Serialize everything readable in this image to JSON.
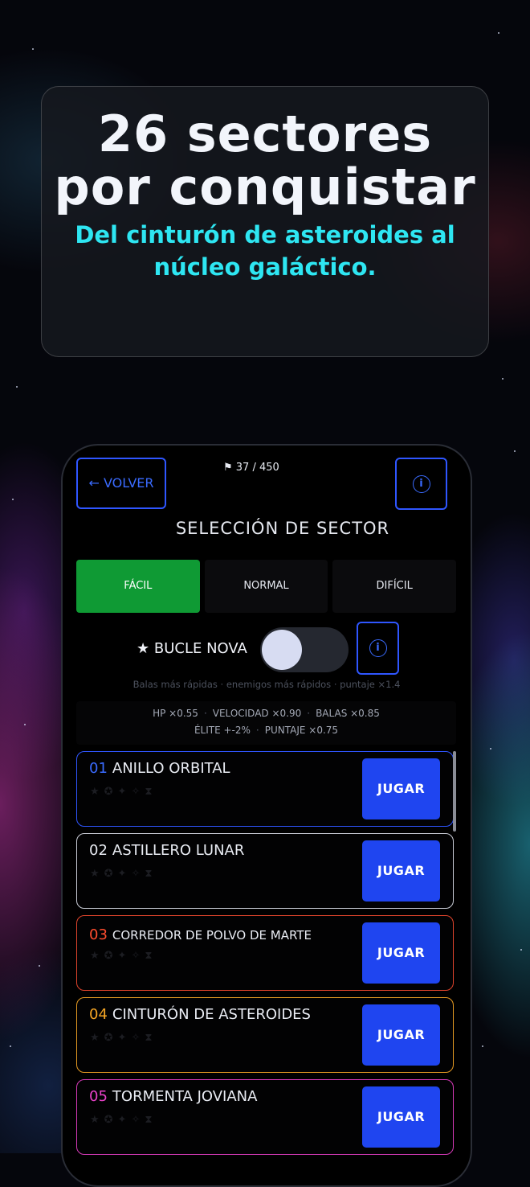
{
  "hero": {
    "title": "26 sectores por conquistar",
    "subtitle": "Del cinturón de asteroides al núcleo galáctico."
  },
  "header": {
    "back_label": "← VOLVER",
    "counter": "⚑ 37 / 450",
    "title": "SELECCIÓN DE SECTOR"
  },
  "difficulty": {
    "tabs": [
      {
        "label": "FÁCIL",
        "active": true
      },
      {
        "label": "NORMAL",
        "active": false
      },
      {
        "label": "DIFÍCIL",
        "active": false
      }
    ]
  },
  "nova": {
    "label": "★ BUCLE NOVA",
    "enabled": false,
    "description": "Balas más rápidas · enemigos más rápidos · puntaje ×1.4"
  },
  "modifiers": {
    "hp": "HP ×0.55",
    "speed": "VELOCIDAD ×0.90",
    "bullets": "BALAS ×0.85",
    "elite": "ÉLITE +-2%",
    "score": "PUNTAJE ×0.75"
  },
  "sectors": [
    {
      "num": "01",
      "name": "ANILLO ORBITAL",
      "color": "#2f56ff",
      "num_color": "#3a6bff",
      "play": "JUGAR"
    },
    {
      "num": "02",
      "name": "ASTILLERO LUNAR",
      "color": "#c9ccd6",
      "num_color": "#e9ecf3",
      "play": "JUGAR"
    },
    {
      "num": "03",
      "name": "CORREDOR DE POLVO DE MARTE",
      "color": "#e0442c",
      "num_color": "#ff4d2e",
      "play": "JUGAR"
    },
    {
      "num": "04",
      "name": "CINTURÓN DE ASTEROIDES",
      "color": "#e59a22",
      "num_color": "#f5a524",
      "play": "JUGAR"
    },
    {
      "num": "05",
      "name": "TORMENTA JOVIANA",
      "color": "#d63ab8",
      "num_color": "#ea42c9",
      "play": "JUGAR"
    }
  ],
  "colors": {
    "accent": "#2f56ff",
    "active_tab": "#0f9a34",
    "hero_subtitle": "#2ee6f2"
  }
}
